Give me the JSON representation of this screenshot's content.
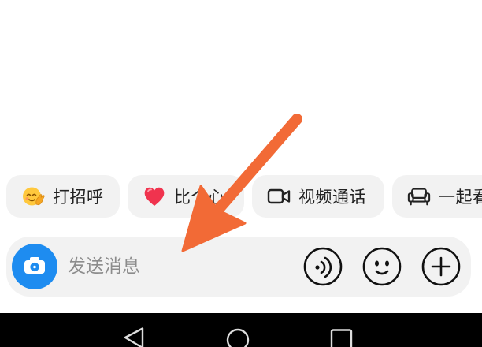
{
  "quick_actions": [
    {
      "label": "打招呼",
      "icon": "wave-emoji-icon"
    },
    {
      "label": "比个心",
      "icon": "heart-icon"
    },
    {
      "label": "视频通话",
      "icon": "video-camera-icon"
    },
    {
      "label": "一起看",
      "icon": "sofa-icon"
    }
  ],
  "composer": {
    "camera_icon": "camera-icon",
    "placeholder": "发送消息",
    "actions": [
      {
        "icon": "voice-icon"
      },
      {
        "icon": "emoji-icon"
      },
      {
        "icon": "plus-icon"
      }
    ]
  },
  "nav_bar": {
    "icons": [
      "back-icon",
      "home-icon",
      "recents-icon"
    ]
  },
  "annotation": {
    "icon": "arrow-icon",
    "color": "#F26A36"
  },
  "colors": {
    "accent": "#1E8CF0",
    "chip_bg": "#F2F2F2",
    "nav_bg": "#000000"
  }
}
